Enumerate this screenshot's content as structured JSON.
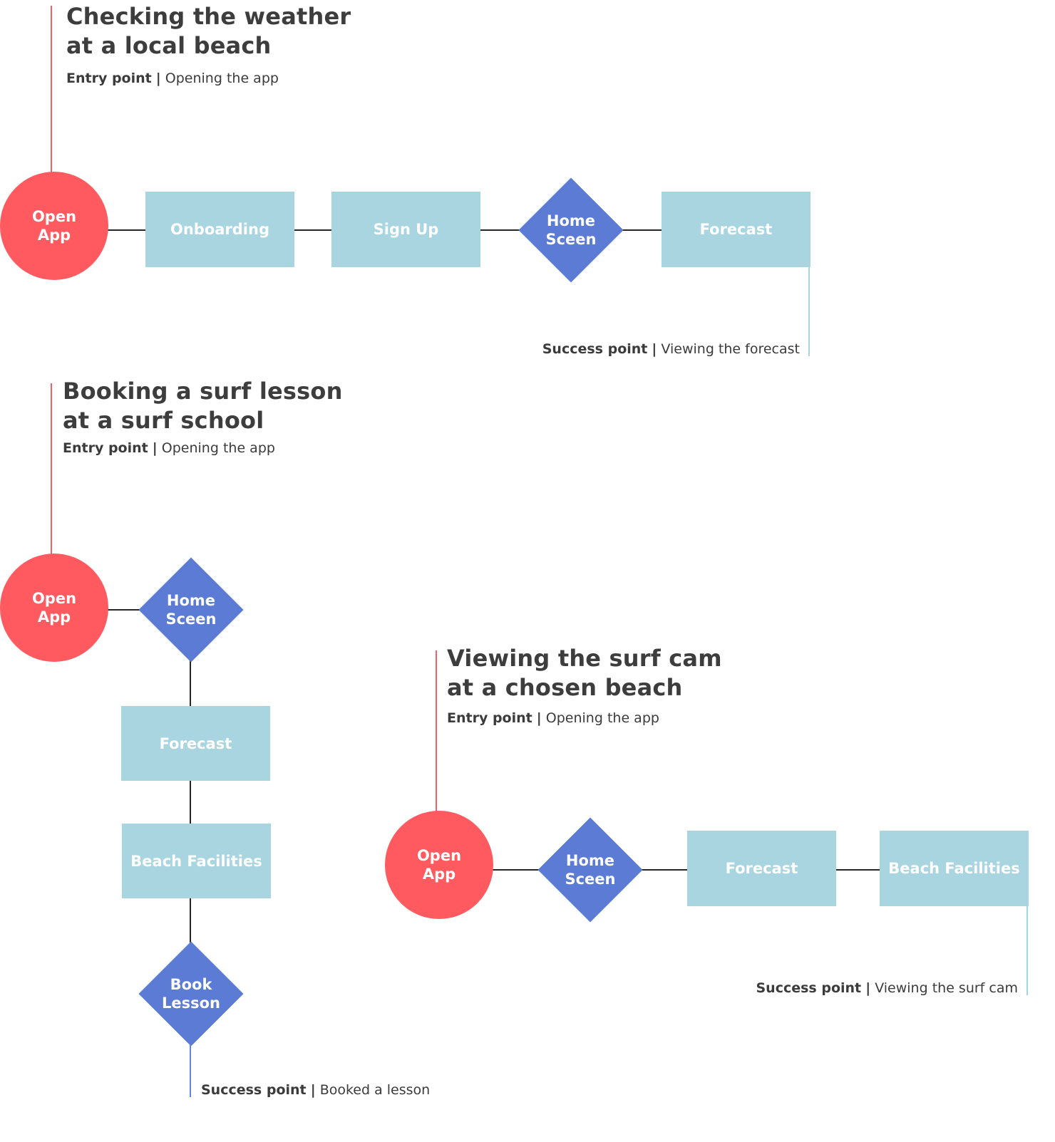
{
  "flows": [
    {
      "title_line1": "Checking the weather",
      "title_line2": "at a local beach",
      "entry_label": "Entry point",
      "entry_text": "Opening the app",
      "success_label": "Success point",
      "success_text": "Viewing the forecast",
      "nodes": [
        {
          "type": "circle",
          "line1": "Open",
          "line2": "App"
        },
        {
          "type": "rect",
          "label": "Onboarding"
        },
        {
          "type": "rect",
          "label": "Sign Up"
        },
        {
          "type": "diamond",
          "line1": "Home",
          "line2": "Sceen"
        },
        {
          "type": "rect",
          "label": "Forecast"
        }
      ]
    },
    {
      "title_line1": "Booking a surf lesson",
      "title_line2": "at a surf school",
      "entry_label": "Entry point",
      "entry_text": "Opening the app",
      "success_label": "Success point",
      "success_text": "Booked a lesson",
      "nodes": [
        {
          "type": "circle",
          "line1": "Open",
          "line2": "App"
        },
        {
          "type": "diamond",
          "line1": "Home",
          "line2": "Sceen"
        },
        {
          "type": "rect",
          "label": "Forecast"
        },
        {
          "type": "rect",
          "label": "Beach Facilities"
        },
        {
          "type": "diamond",
          "line1": "Book",
          "line2": "Lesson"
        }
      ]
    },
    {
      "title_line1": "Viewing the surf cam",
      "title_line2": "at a chosen beach",
      "entry_label": "Entry point",
      "entry_text": "Opening the app",
      "success_label": "Success point",
      "success_text": "Viewing the surf cam",
      "nodes": [
        {
          "type": "circle",
          "line1": "Open",
          "line2": "App"
        },
        {
          "type": "diamond",
          "line1": "Home",
          "line2": "Sceen"
        },
        {
          "type": "rect",
          "label": "Forecast"
        },
        {
          "type": "rect",
          "label": "Beach Facilities"
        }
      ]
    }
  ],
  "separator": "|",
  "colors": {
    "start_circle": "#ff5a5f",
    "decision_diamond": "#5b7bd5",
    "screen_rect": "#a8d5e0",
    "connector": "#262626",
    "entry_line": "#f0626a",
    "text": "#3d3d3d"
  }
}
